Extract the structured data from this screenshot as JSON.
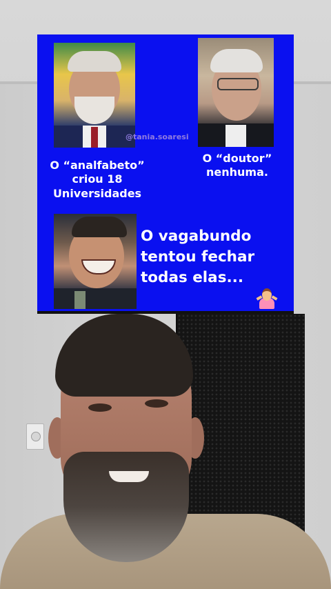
{
  "meme": {
    "watermark": "@tania.soaresi",
    "caption_lula": [
      "O “analfabeto”",
      "criou 18",
      "Universidades"
    ],
    "caption_fhc": [
      "O “doutor”",
      "nenhuma."
    ],
    "caption_bolso": [
      "O vagabundo",
      "tentou fechar",
      "todas elas..."
    ],
    "background_color": "#0a10f0",
    "caption_color": "#ffffff",
    "emoji": "person-shrugging-icon"
  }
}
